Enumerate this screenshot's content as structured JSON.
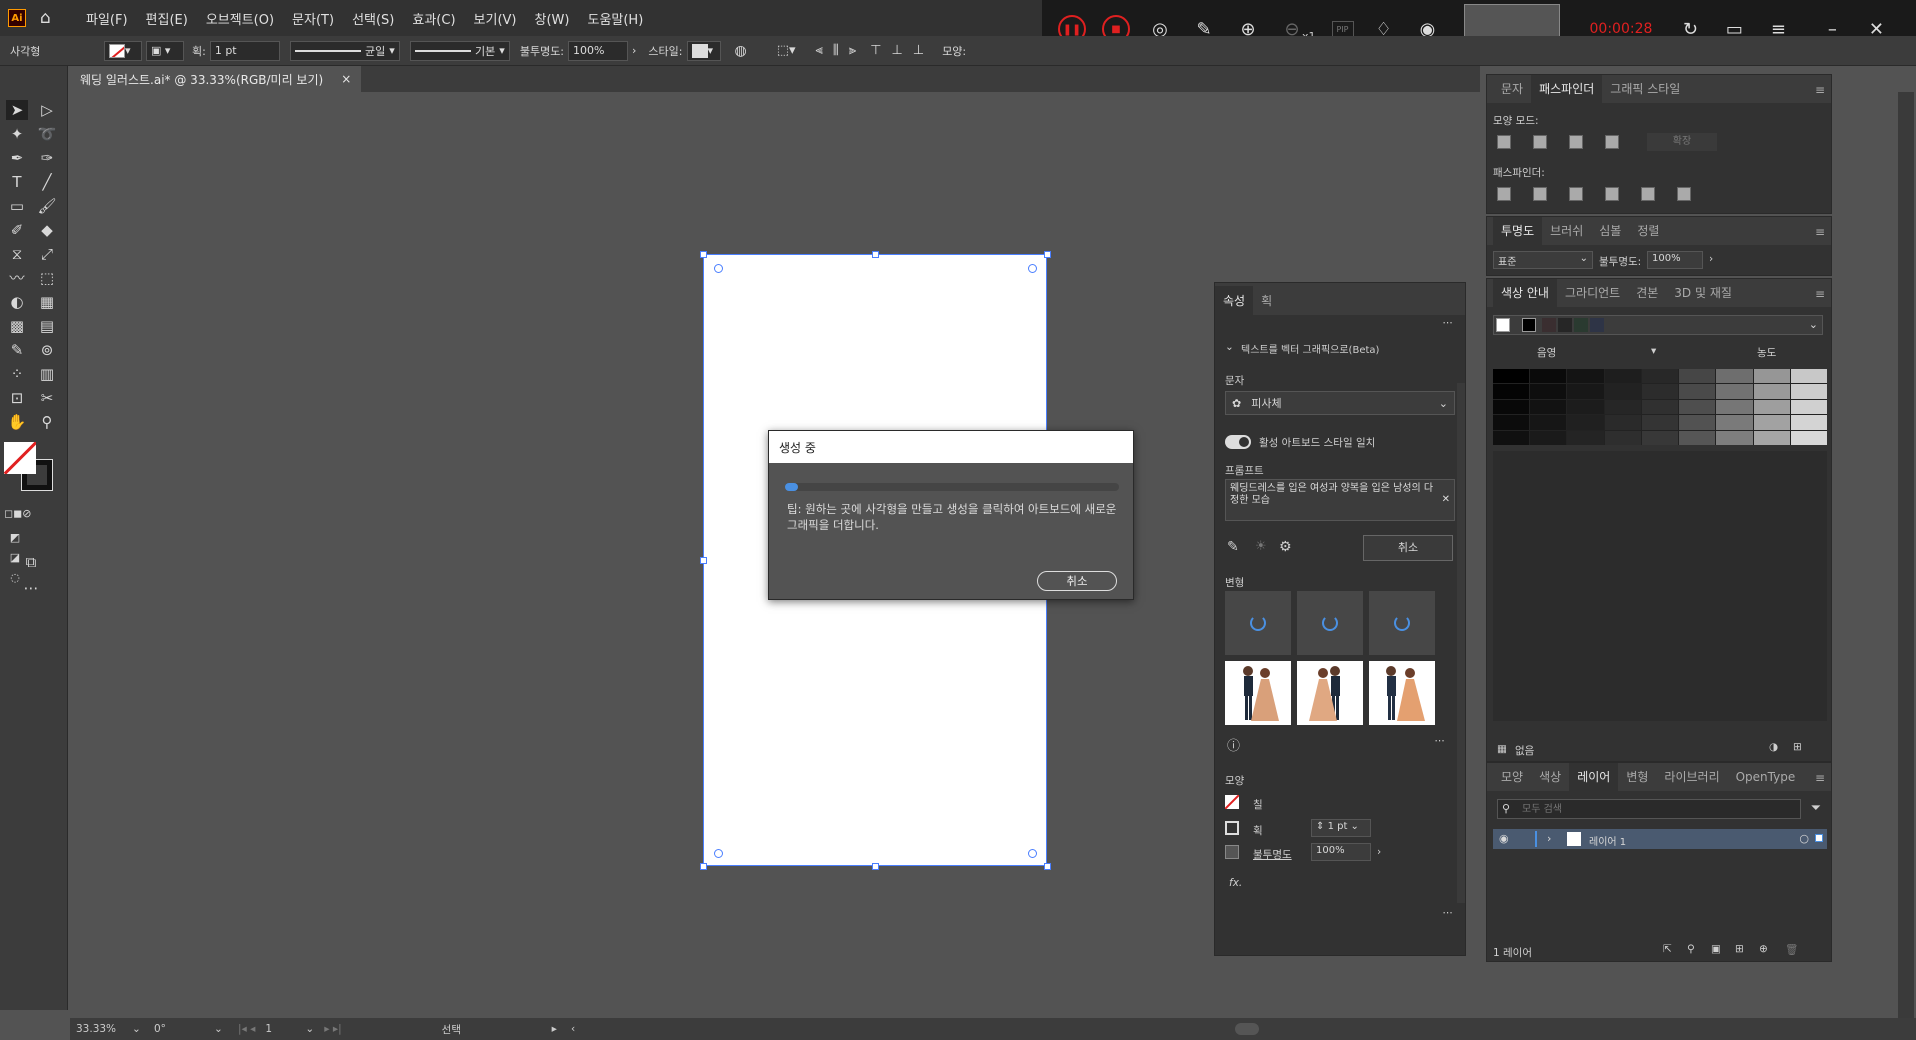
{
  "app": {
    "logo": "Ai",
    "tool_name": "사각형",
    "doc_tab": "웨딩 일러스트.ai* @ 33.33%(RGB/미리 보기)"
  },
  "menu": [
    "파일(F)",
    "편집(E)",
    "오브젝트(O)",
    "문자(T)",
    "선택(S)",
    "효과(C)",
    "보기(V)",
    "창(W)",
    "도움말(H)"
  ],
  "recorder": {
    "time": "00:00:28",
    "zoom_mult": "x1",
    "pip": "PIP"
  },
  "control": {
    "stroke_label": "획:",
    "stroke_value": "1 pt",
    "stroke_style": "균일",
    "brush": "기본",
    "opacity_label": "불투명도:",
    "opacity": "100%",
    "style_label": "스타일:",
    "shape_label": "모양:"
  },
  "dialog": {
    "title": "생성 중",
    "progress": 0.04,
    "tip": "팁: 원하는 곳에 사각형을 만들고 생성을 클릭하여 아트보드에 새로운 그래픽을 더합니다.",
    "cancel": "취소"
  },
  "props": {
    "tabs": [
      "속성",
      "획"
    ],
    "section": "텍스트를 벡터 그래픽으로(Beta)",
    "type_label": "문자",
    "type_value": "피사체",
    "match_style": "활성 아트보드 스타일 일치",
    "prompt_label": "프롬프트",
    "prompt": "웨딩드레스를 입은 여성과 양복을 입은 남성의 다정한 모습",
    "cancel": "취소",
    "variations_label": "변형",
    "appearance_label": "모양",
    "fill": "칠",
    "stroke": "획",
    "stroke_value": "1 pt",
    "opacity_label": "불투명도",
    "opacity": "100%"
  },
  "pathfinder": {
    "tabs": [
      "문자",
      "패스파인더",
      "그래픽 스타일"
    ],
    "shape_modes": "모양 모드:",
    "expand": "확장",
    "pathfinders": "패스파인더:"
  },
  "transparency": {
    "tabs": [
      "투명도",
      "브러쉬",
      "심볼",
      "정렬"
    ],
    "mode": "표준",
    "opacity_label": "불투명도:",
    "opacity": "100%"
  },
  "color_guide": {
    "tabs": [
      "색상 안내",
      "그라디언트",
      "견본",
      "3D 및 재질"
    ],
    "shade": "음영",
    "tint": "농도",
    "none": "없음"
  },
  "layers": {
    "tabs": [
      "모양",
      "색상",
      "레이어",
      "변형",
      "라이브러리",
      "OpenType"
    ],
    "search_placeholder": "모두 검색",
    "layer1": "레이어 1",
    "count": "1 레이어"
  },
  "status": {
    "zoom": "33.33%",
    "angle": "0°",
    "page": "1",
    "tool": "선택"
  },
  "colors": {
    "accent": "#4a90e2",
    "rec_red": "#e02020"
  }
}
